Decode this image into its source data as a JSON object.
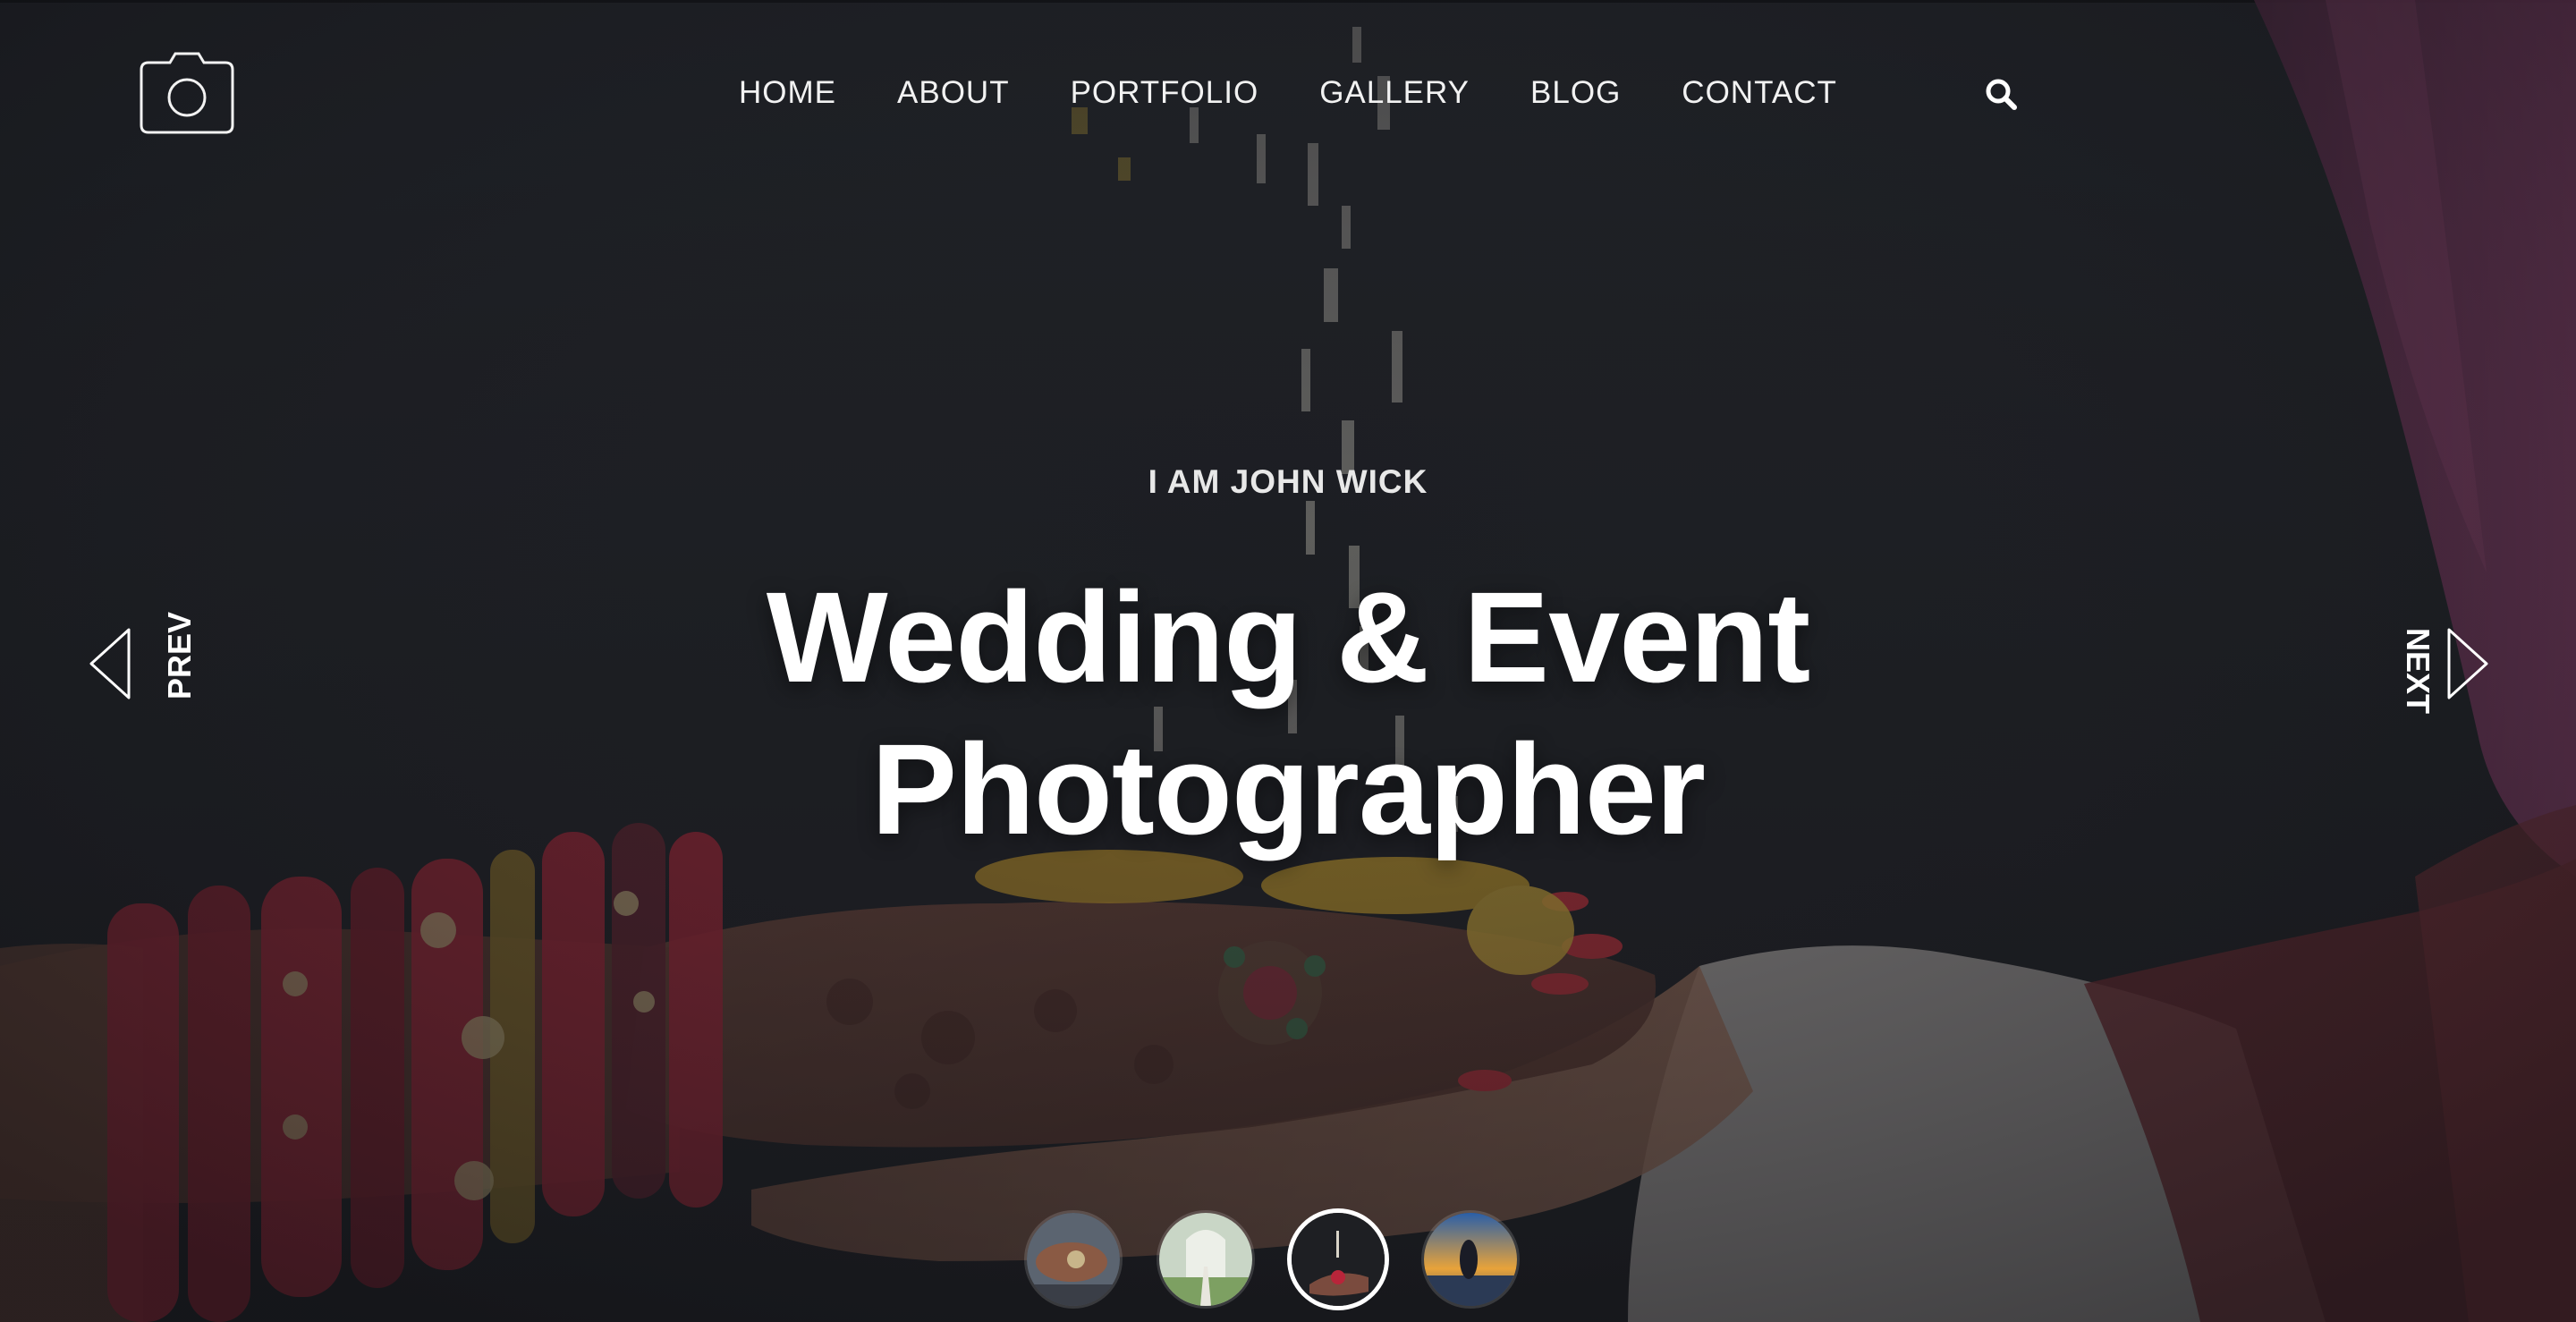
{
  "nav": {
    "items": [
      "HOME",
      "ABOUT",
      "PORTFOLIO",
      "GALLERY",
      "BLOG",
      "CONTACT"
    ]
  },
  "icons": {
    "logo": "camera-icon",
    "search": "search-icon",
    "prev": "chevron-left-icon",
    "next": "chevron-right-icon"
  },
  "hero": {
    "kicker": "I AM JOHN WICK",
    "title_line1": "Wedding & Event",
    "title_line2": "Photographer"
  },
  "slider": {
    "prev_label": "PREV",
    "next_label": "NEXT",
    "active_index": 2,
    "thumb_count": 4
  },
  "colors": {
    "background": "#222329",
    "text": "#ffffff",
    "accent_red": "#b8253a",
    "curtain_pink": "#a23a72"
  }
}
